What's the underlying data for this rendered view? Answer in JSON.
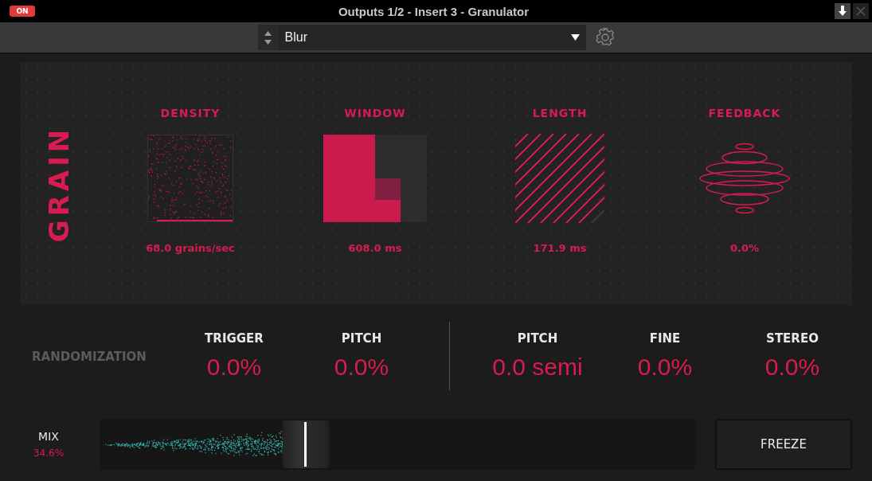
{
  "window": {
    "title": "Outputs 1/2 - Insert 3 - Granulator",
    "power": {
      "label": "ON",
      "on": true
    }
  },
  "preset": {
    "value": "Blur"
  },
  "grain": {
    "title": "GRAIN",
    "params": [
      {
        "kind": "density",
        "label": "DENSITY",
        "value": "68.0 grains/sec"
      },
      {
        "kind": "window",
        "label": "WINDOW",
        "value": "608.0 ms"
      },
      {
        "kind": "length",
        "label": "LENGTH",
        "value": "171.9 ms"
      },
      {
        "kind": "feedback",
        "label": "FEEDBACK",
        "value": "0.0%"
      }
    ]
  },
  "randomization": {
    "title": "RANDOMIZATION",
    "groups": [
      {
        "params": [
          {
            "label": "TRIGGER",
            "value": "0.0%"
          },
          {
            "label": "PITCH",
            "value": "0.0%"
          }
        ]
      },
      {
        "params": [
          {
            "label": "PITCH",
            "value": "0.0 semi"
          },
          {
            "label": "FINE",
            "value": "0.0%"
          },
          {
            "label": "STEREO",
            "value": "0.0%"
          }
        ]
      }
    ]
  },
  "mix": {
    "label": "MIX",
    "reading": "34.6%",
    "level": 0.346
  },
  "freeze": {
    "label": "FREEZE"
  }
}
